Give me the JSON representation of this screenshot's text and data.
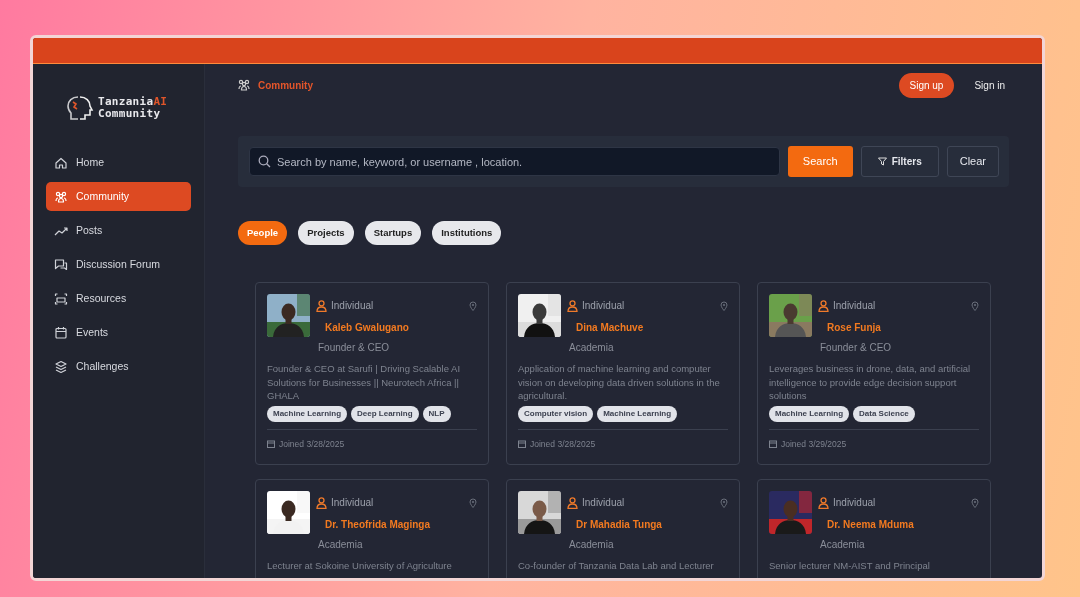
{
  "brand": {
    "name": "Tanzania",
    "accent": "AI",
    "subtitle": "Community"
  },
  "sidebar": {
    "items": [
      {
        "label": "Home",
        "kind": "home",
        "selected": false
      },
      {
        "label": "Community",
        "kind": "community",
        "selected": true
      },
      {
        "label": "Posts",
        "kind": "trend",
        "selected": false
      },
      {
        "label": "Discussion Forum",
        "kind": "chat",
        "selected": false
      },
      {
        "label": "Resources",
        "kind": "resources",
        "selected": false
      },
      {
        "label": "Events",
        "kind": "calendar",
        "selected": false
      },
      {
        "label": "Challenges",
        "kind": "stack",
        "selected": false
      }
    ]
  },
  "breadcrumb": "Community",
  "auth": {
    "signup": "Sign up",
    "signin": "Sign in"
  },
  "search": {
    "placeholder": "Search by name, keyword, or username , location.",
    "button": "Search",
    "filters": "Filters",
    "clear": "Clear"
  },
  "filter_tabs": [
    {
      "label": "People",
      "selected": true
    },
    {
      "label": "Projects",
      "selected": false
    },
    {
      "label": "Startups",
      "selected": false
    },
    {
      "label": "Institutions",
      "selected": false
    }
  ],
  "people": [
    {
      "type": "Individual",
      "name": "Kaleb Gwalugano",
      "role": "Founder & CEO",
      "bio": "Founder & CEO at Sarufi | Driving Scalable AI Solutions for Businesses || Neurotech Africa || GHALA",
      "tags": [
        "Machine Learning",
        "Deep Learning",
        "NLP"
      ],
      "joined": "Joined 3/28/2025"
    },
    {
      "type": "Individual",
      "name": "Dina Machuve",
      "role": "Academia",
      "bio": "Application of machine learning and computer vision on developing data driven solutions in the agricultural.",
      "tags": [
        "Computer vision",
        "Machine Learning"
      ],
      "joined": "Joined 3/28/2025"
    },
    {
      "type": "Individual",
      "name": "Rose Funja",
      "role": "Founder & CEO",
      "bio": "Leverages business in drone, data, and artificial intelligence to provide edge decision support solutions",
      "tags": [
        "Machine Learning",
        "Data Science"
      ],
      "joined": "Joined 3/29/2025"
    },
    {
      "type": "Individual",
      "name": "Dr. Theofrida Maginga",
      "role": "Academia",
      "bio": "Lecturer at Sokoine University of Agriculture"
    },
    {
      "type": "Individual",
      "name": "Dr Mahadia Tunga",
      "role": "Academia",
      "bio": "Co-founder of Tanzania Data Lab and Lecturer"
    },
    {
      "type": "Individual",
      "name": "Dr. Neema Mduma",
      "role": "Academia",
      "bio": "Senior lecturer NM-AIST and Principal"
    }
  ]
}
